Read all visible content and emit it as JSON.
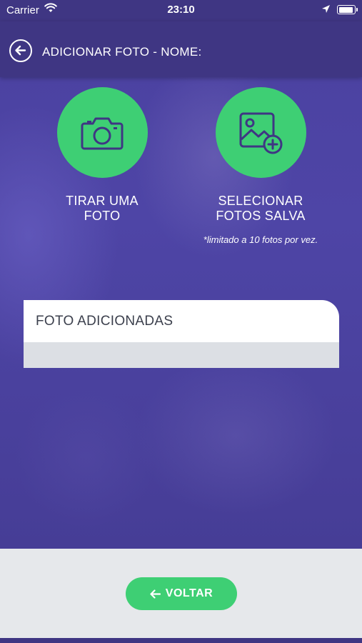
{
  "status_bar": {
    "carrier": "Carrier",
    "time": "23:10"
  },
  "header": {
    "title": "ADICIONAR FOTO - NOME:"
  },
  "actions": {
    "take_photo_line1": "TIRAR UMA",
    "take_photo_line2": "FOTO",
    "select_photo_line1": "SELECIONAR",
    "select_photo_line2": "FOTOS SALVA",
    "limit_note": "*limitado a 10 fotos por vez."
  },
  "added_photos": {
    "title": "FOTO ADICIONADAS"
  },
  "footer": {
    "back_label": "VOLTAR"
  },
  "colors": {
    "brand_purple": "#3f3683",
    "accent_green": "#3ecf74"
  },
  "icons": [
    "wifi-icon",
    "location-arrow-icon",
    "battery-icon",
    "back-arrow-icon",
    "camera-icon",
    "image-add-icon",
    "arrow-left-icon"
  ]
}
